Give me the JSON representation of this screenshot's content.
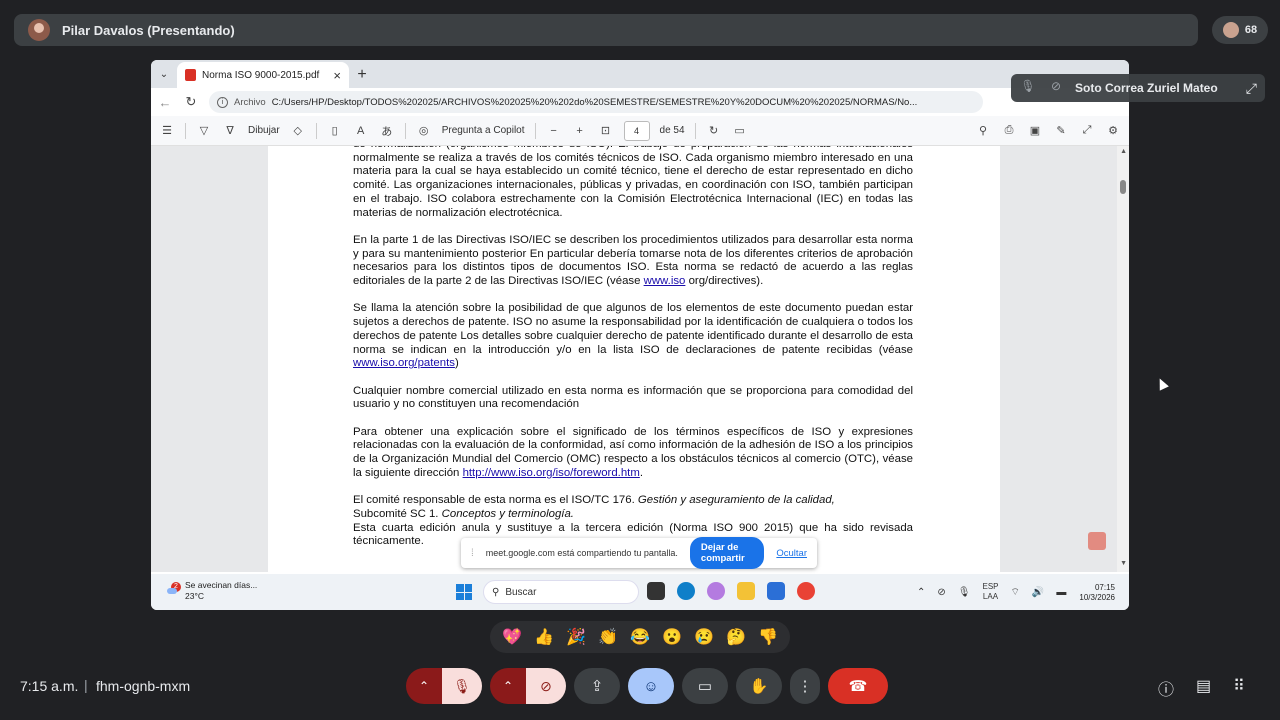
{
  "meet": {
    "presenter": "Pilar Davalos (Presentando)",
    "participants_count": "68",
    "time": "7:15 a.m.",
    "separator": "|",
    "meeting_code": "fhm-ognb-mxm",
    "pinned_tile": {
      "name": "Soto Correa Zuriel Mateo"
    },
    "reactions": [
      "💖",
      "👍",
      "🎉",
      "👏",
      "😂",
      "😮",
      "😢",
      "🤔",
      "👎"
    ],
    "share_notice": {
      "text": "meet.google.com está compartiendo tu pantalla.",
      "stop_label": "Dejar de compartir",
      "hide_label": "Ocultar"
    }
  },
  "browser": {
    "tab_title": "Norma ISO 9000-2015.pdf",
    "address_prefix": "Archivo",
    "url": "C:/Users/HP/Desktop/TODOS%202025/ARCHIVOS%202025%20%202do%20SEMESTRE/SEMESTRE%20Y%20DOCUM%20%202025/NORMAS/No...",
    "pdf_toolbar": {
      "draw_label": "Dibujar",
      "copilot_label": "Pregunta a Copilot",
      "page_current": "4",
      "page_total": "de 54"
    }
  },
  "document": {
    "para1": "de normalización (organismos miembros de ISO). El trabajo de preparación de las normas internacionales normalmente se realiza a través de los comités técnicos de ISO. Cada organismo miembro interesado en una materia para la cual se haya establecido un comité técnico, tiene el derecho de estar representado en dicho comité. Las organizaciones internacionales, públicas y privadas, en coordinación con ISO, también participan en el trabajo. ISO colabora estrechamente con la Comisión Electrotécnica Internacional (IEC) en todas las materias de normalización electrotécnica.",
    "para2": "En la parte 1 de las Directivas ISO/IEC se describen los procedimientos utilizados para desarrollar esta norma y para su mantenimiento posterior En particular debería tomarse nota de los diferentes criterios de aprobación necesarios para los distintos tipos de documentos ISO. Esta norma se redactó de acuerdo a las reglas editoriales de la parte 2 de las Directivas ISO/IEC (véase",
    "para2_link": "www.iso",
    "para2_end": "org/directives).",
    "para3": "Se llama la atención sobre la posibilidad de que algunos de los elementos de este documento puedan estar sujetos a derechos de patente. ISO no asume la responsabilidad por la identificación de cualquiera o todos los derechos de patente Los detalles sobre cualquier derecho de patente identificado durante el desarrollo de esta norma se indican en la introducción y/o en la lista ISO de declaraciones de patente recibidas (véase",
    "para3_link": "www.iso.org/patents",
    "para3_end": ")",
    "para4": "Cualquier nombre comercial utilizado en esta norma es información que se proporciona para comodidad del usuario y no constituyen una recomendación",
    "para5": "Para obtener una explicación sobre el significado de los términos específicos de ISO y expresiones relacionadas con la evaluación de la conformidad, así como información de la adhesión de ISO a los principios de la Organización Mundial del Comercio (OMC) respecto a los obstáculos técnicos al comercio (OTC), véase la siguiente dirección",
    "para5_link": "http://www.iso.org/iso/foreword.htm",
    "para5_end": ".",
    "para6a": "El comité responsable de esta norma es el ISO/TC 176.",
    "para6a_italic": "Gestión y aseguramiento de la calidad,",
    "para6b": "Subcomité SC 1.",
    "para6b_italic": "Conceptos y terminología.",
    "para6c": "Esta cuarta edición anula y sustituye a la tercera edición (Norma ISO 900 2015) que ha sido revisada técnicamente."
  },
  "taskbar": {
    "weather_title": "Se avecinan días...",
    "weather_temp": "23°C",
    "weather_badge": "2",
    "search_placeholder": "Buscar",
    "lang_top": "ESP",
    "lang_bottom": "LAA",
    "clock_time": "07:15",
    "clock_date": "10/3/2026"
  }
}
